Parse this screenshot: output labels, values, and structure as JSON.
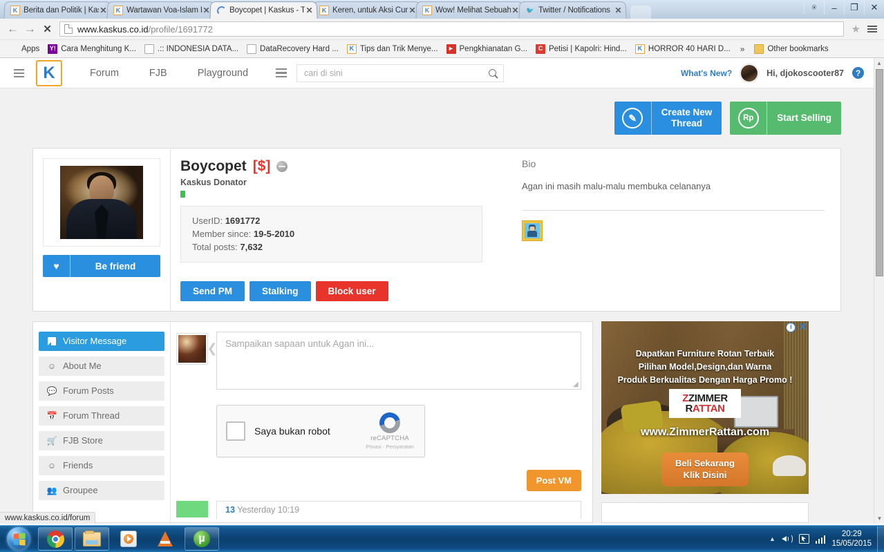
{
  "browser": {
    "tabs": [
      {
        "title": "Berita dan Politik | Kask",
        "icon": "kaskus-favicon",
        "active": false
      },
      {
        "title": "Wartawan Voa-Islam Di",
        "icon": "kaskus-favicon",
        "active": false
      },
      {
        "title": "Boycopet | Kaskus - The",
        "icon": "loading-spinner",
        "active": true
      },
      {
        "title": "Keren, untuk Aksi Curi",
        "icon": "kaskus-favicon",
        "active": false
      },
      {
        "title": "Wow! Melihat Sebuah",
        "icon": "kaskus-favicon",
        "active": false
      },
      {
        "title": "Twitter / Notifications",
        "icon": "twitter-favicon",
        "active": false
      }
    ],
    "close_label": "✕",
    "window_controls": {
      "user": "⍟",
      "minimize": "‒",
      "maximize": "❐",
      "close": "✕"
    },
    "nav": {
      "back": "←",
      "forward": "→",
      "stop": "✕"
    },
    "url_domain": "www.kaskus.co.id",
    "url_path": "/profile/1691772",
    "star": "★",
    "bookmarks": [
      {
        "label": "Apps",
        "icon": "apps-grid-icon"
      },
      {
        "label": "Cara Menghitung K...",
        "icon": "yahoo-icon"
      },
      {
        "label": ".:: INDONESIA DATA...",
        "icon": "document-icon"
      },
      {
        "label": "DataRecovery Hard ...",
        "icon": "document-icon"
      },
      {
        "label": "Tips dan Trik Menye...",
        "icon": "kaskus-icon"
      },
      {
        "label": "Pengkhianatan G...",
        "icon": "youtube-icon"
      },
      {
        "label": "Petisi | Kapolri: Hind...",
        "icon": "change-org-icon"
      },
      {
        "label": "HORROR 40 HARI D...",
        "icon": "kaskus-icon"
      }
    ],
    "bookmark_overflow": "»",
    "other_bookmarks": "Other bookmarks",
    "status_text": "www.kaskus.co.id/forum"
  },
  "site_nav": {
    "menu_icon": "hamburger-icon",
    "logo": "K",
    "links": [
      "Forum",
      "FJB",
      "Playground"
    ],
    "search_placeholder": "cari di sini",
    "search_value": "",
    "whats_new": "What's New?",
    "greeting": "Hi, djokoscooter87",
    "help": "?"
  },
  "cta": {
    "create_thread": {
      "label": "Create New\nThread",
      "line1": "Create New",
      "line2": "Thread",
      "icon": "pencil-icon",
      "color": "#2b8fdf"
    },
    "start_selling": {
      "label": "Start Selling",
      "icon": "rupiah-icon",
      "icon_text": "Rp",
      "color": "#56bb6e"
    }
  },
  "profile": {
    "be_friend": "Be friend",
    "heart_icon": "♥",
    "username": "Boycopet",
    "donator_tag": "[$]",
    "status_icon": "offline-status-icon",
    "rank": "Kaskus Donator",
    "info": {
      "userid_label": "UserID:",
      "userid": "1691772",
      "member_since_label": "Member since:",
      "member_since": "19-5-2010",
      "total_posts_label": "Total posts:",
      "total_posts": "7,632"
    },
    "buttons": {
      "send_pm": "Send PM",
      "stalking": "Stalking",
      "block_user": "Block user"
    },
    "bio_title": "Bio",
    "bio_text": "Agan ini masih malu-malu membuka celananya"
  },
  "sidebar": {
    "items": [
      {
        "label": "Visitor Message",
        "icon": "message-flag-icon",
        "active": true
      },
      {
        "label": "About Me",
        "icon": "person-badge-icon",
        "active": false
      },
      {
        "label": "Forum Posts",
        "icon": "speech-bubble-icon",
        "active": false
      },
      {
        "label": "Forum Thread",
        "icon": "calendar-icon",
        "active": false
      },
      {
        "label": "FJB Store",
        "icon": "shopping-cart-icon",
        "active": false
      },
      {
        "label": "Friends",
        "icon": "friends-icon",
        "active": false
      },
      {
        "label": "Groupee",
        "icon": "group-icon",
        "active": false
      }
    ]
  },
  "composer": {
    "placeholder": "Sampaikan sapaan untuk Agan ini...",
    "value": "",
    "captcha": {
      "checkbox_label": "Saya bukan robot",
      "brand": "reCAPTCHA",
      "terms": "Privasi - Persyaratan"
    },
    "post_button": "Post VM"
  },
  "visitor_messages": [
    {
      "author_fragment": "13",
      "timestamp": "Yesterday 10:19"
    }
  ],
  "ad": {
    "info_icon": "ⓘ",
    "close_icon": "✕",
    "line1": "Dapatkan Furniture Rotan Terbaik",
    "line2": "Pilihan Model,Design,dan Warna",
    "line3": "Produk Berkualitas Dengan Harga Promo !",
    "logo_top": "ZIMMER",
    "logo_bottom": "RATTAN",
    "url": "www.ZimmerRattan.com",
    "cta_line1": "Beli Sekarang",
    "cta_line2": "Klik Disini"
  },
  "taskbar": {
    "start": "windows-start-orb",
    "items": [
      {
        "name": "chrome-taskbar-icon"
      },
      {
        "name": "explorer-taskbar-icon"
      },
      {
        "name": "media-player-taskbar-icon"
      },
      {
        "name": "vlc-taskbar-icon"
      },
      {
        "name": "utorrent-taskbar-icon"
      }
    ],
    "tray": {
      "show_hidden": "▲",
      "volume": "speaker-icon",
      "action_center": "action-center-icon",
      "network": "network-signal-icon"
    },
    "clock_time": "20:29",
    "clock_date": "15/05/2015"
  }
}
